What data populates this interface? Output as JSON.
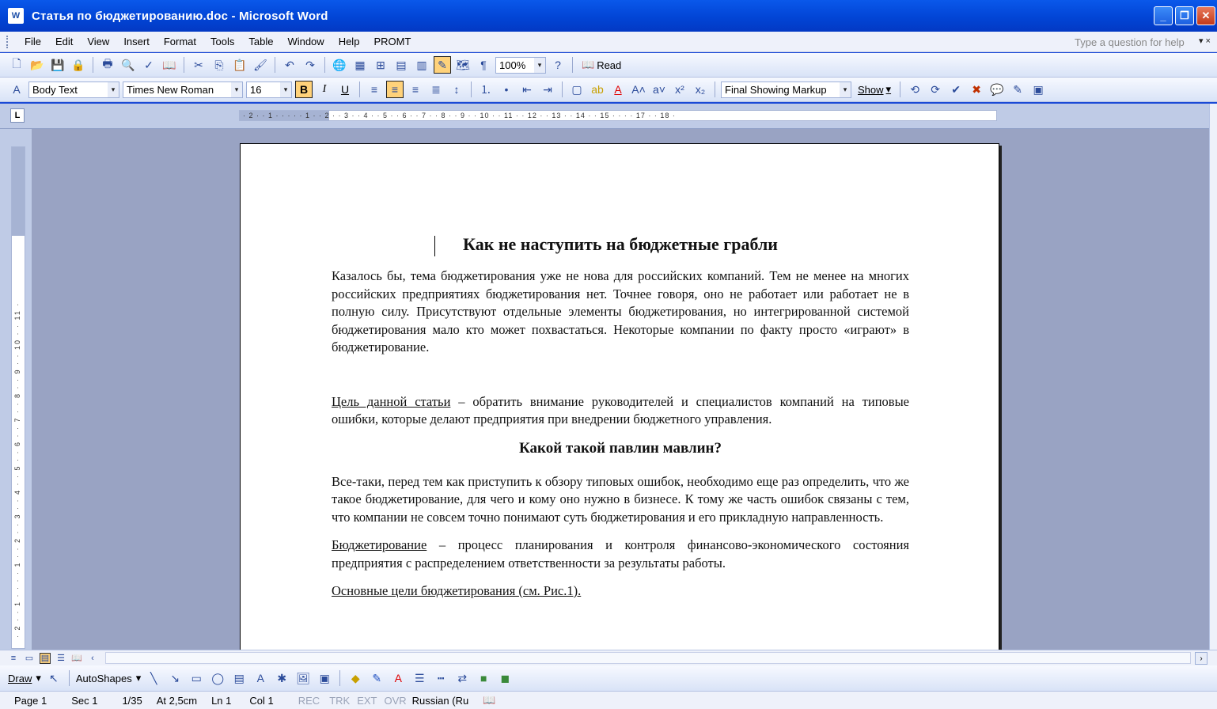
{
  "window": {
    "title": "Статья по бюджетированию.doc - Microsoft Word",
    "app_icon": "W"
  },
  "menu": [
    "File",
    "Edit",
    "View",
    "Insert",
    "Format",
    "Tools",
    "Table",
    "Window",
    "Help",
    "PROMT"
  ],
  "help_box": {
    "placeholder": "Type a question for help"
  },
  "standard_toolbar": {
    "zoom": "100%",
    "read_label": "Read"
  },
  "formatting_toolbar": {
    "style": "Body Text",
    "font": "Times New Roman",
    "size": "16",
    "markup": "Final Showing Markup",
    "show_label": "Show",
    "bold": "B",
    "italic": "I",
    "underline": "U"
  },
  "ruler": {
    "h_ticks": "· 2 · · 1 · · · · · 1 · · 2 · · 3 · · 4 · · 5 · · 6 · · 7 · · 8 · · 9 · · 10 · · 11 · · 12 · · 13 · · 14 · · 15 · · · · 17 · · 18 ·",
    "v_ticks": "· 2 · · 1 · · · · 1 · · 2 · · 3 · · 4 · · 5 · · 6 · · 7 · · 8 · · 9 · · 10 · · 11 ·"
  },
  "document": {
    "heading": "Как не наступить на бюджетные грабли",
    "p1": "Казалось бы, тема бюджетирования уже не нова для российских компаний. Тем не менее на многих российских предприятиях бюджетирования нет. Точнее говоря, оно не работает или работает не в полную силу. Присутствуют отдельные элементы бюджетирования, но интегрированной системой бюджетирования мало кто может похвастаться. Некоторые компании по факту просто «играют» в бюджетирование.",
    "p2_term": "Цель данной статьи",
    "p2_rest": " – обратить внимание руководителей и специалистов компаний на типовые ошибки, которые делают предприятия при внедрении бюджетного управления.",
    "subheading": "Какой такой павлин мавлин?",
    "p3": "Все-таки, перед тем как приступить к обзору типовых ошибок, необходимо еще раз определить, что же такое бюджетирование, для чего и кому оно нужно в бизнесе. К тому же часть ошибок связаны с тем, что компании не совсем точно понимают суть бюджетирования и его прикладную направленность.",
    "p4_term": "Бюджетирование",
    "p4_rest": " – процесс планирования и контроля финансово-экономического состояния предприятия с распределением ответственности за результаты работы.",
    "p5": "Основные цели бюджетирования (см. Рис.1)."
  },
  "drawing_toolbar": {
    "draw_label": "Draw",
    "autoshapes_label": "AutoShapes"
  },
  "status": {
    "page": "Page 1",
    "sec": "Sec 1",
    "pages": "1/35",
    "at": "At 2,5cm",
    "ln": "Ln 1",
    "col": "Col 1",
    "rec": "REC",
    "trk": "TRK",
    "ext": "EXT",
    "ovr": "OVR",
    "lang": "Russian (Ru"
  }
}
